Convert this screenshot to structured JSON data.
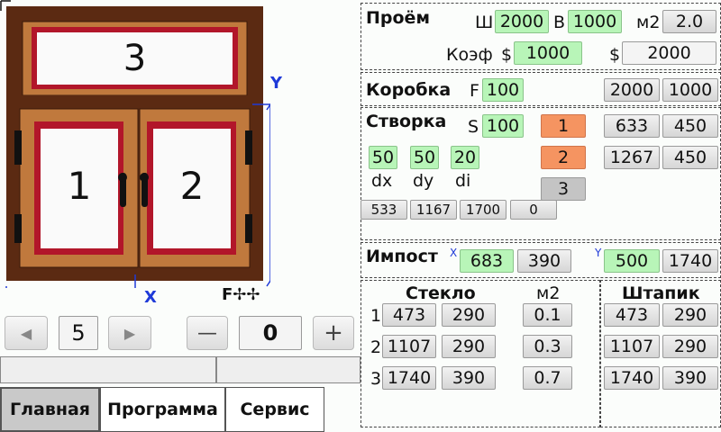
{
  "preview": {
    "top_pane_number": "3",
    "left_sash_number": "1",
    "right_sash_number": "2",
    "x_label": "X",
    "y_label": "Y",
    "f_label": "F"
  },
  "nav": {
    "left_value": "5",
    "right_value": "0",
    "prev_glyph": "◀",
    "next_glyph": "▶",
    "minus_glyph": "—",
    "plus_glyph": "+"
  },
  "tabs": [
    "Главная",
    "Программа",
    "Сервис"
  ],
  "opening": {
    "title": "Проём",
    "w_label": "Ш",
    "w_value": "2000",
    "h_label": "В",
    "h_value": "1000",
    "area_label": "м2",
    "area_value": "2.0",
    "coef_label": "Коэф",
    "currency1": "$",
    "coef_value": "1000",
    "currency2": "$",
    "price_value": "2000"
  },
  "frame": {
    "title": "Коробка",
    "f_label": "F",
    "f_value": "100",
    "w_value": "2000",
    "h_value": "1000"
  },
  "sash": {
    "title": "Створка",
    "s_label": "S",
    "s_value": "100",
    "dx_value": "50",
    "dy_value": "50",
    "di_value": "20",
    "dx_label": "dx",
    "dy_label": "dy",
    "di_label": "di",
    "items": [
      {
        "num": "1",
        "w": "633",
        "h": "450"
      },
      {
        "num": "2",
        "w": "1267",
        "h": "450"
      },
      {
        "num": "3"
      }
    ],
    "row": [
      "533",
      "1167",
      "1700",
      "0"
    ]
  },
  "impost": {
    "title": "Импост",
    "x_label": "X",
    "x_value": "683",
    "x_len": "390",
    "y_label": "Y",
    "y_value": "500",
    "y_len": "1740"
  },
  "glass": {
    "title": "Стекло",
    "area_title": "м2",
    "bead_title": "Штапик",
    "rows": [
      {
        "idx": "1",
        "w": "473",
        "h": "290",
        "area": "0.1",
        "bw": "473",
        "bh": "290"
      },
      {
        "idx": "2",
        "w": "1107",
        "h": "290",
        "area": "0.3",
        "bw": "1107",
        "bh": "290"
      },
      {
        "idx": "3",
        "w": "1740",
        "h": "390",
        "area": "0.7",
        "bw": "1740",
        "bh": "390"
      }
    ]
  },
  "colors": {
    "frame_brown": "#5b2a12",
    "wood_light": "#c0793d",
    "seal_red": "#b2162a",
    "input_green": "#b8f5b8",
    "sash_orange": "#f59461",
    "dim_blue": "#1f3ad8"
  }
}
